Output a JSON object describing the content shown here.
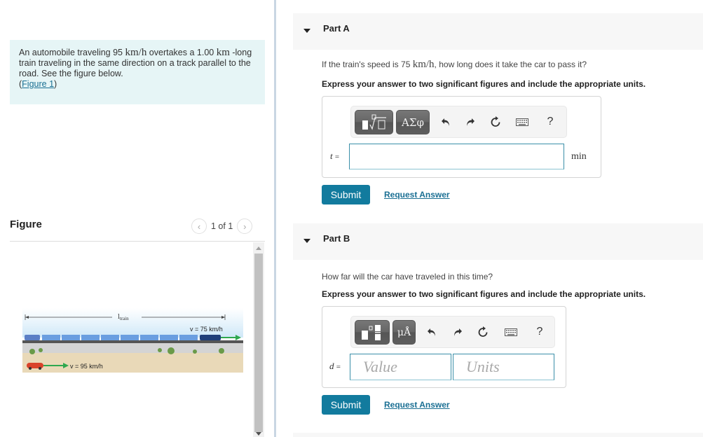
{
  "problem": {
    "text_1": "An automobile traveling 95 ",
    "speed_unit": "km/h",
    "text_2": " overtakes a 1.00 ",
    "length_unit": "km",
    "text_3": " -long train traveling in the same direction on a track parallel to the road. See the figure below.",
    "figure_link_open": "(",
    "figure_link": "Figure 1",
    "figure_link_close": ")"
  },
  "figure": {
    "title": "Figure",
    "counter": "1 of 1",
    "prev_icon": "chevron-left-icon",
    "next_icon": "chevron-right-icon",
    "labels": {
      "length": "l",
      "length_sub": "train",
      "train_speed": "v = 75 km/h",
      "car_speed": "v = 95 km/h"
    },
    "colors": {
      "sky": "#d9eefa",
      "train": "#5b8fd6",
      "car": "#d9432a",
      "arrow": "#2fa84f",
      "ground": "#e9d9b8"
    }
  },
  "parts": [
    {
      "title": "Part A",
      "question_1": "If the train's speed is 75 ",
      "question_unit": "km/h",
      "question_2": ", how long does it take the car to pass it?",
      "instruction": "Express your answer to two significant figures and include the appropriate units.",
      "toolbar": {
        "button_1": "templates-icon",
        "button_2_label": "ΑΣφ",
        "icons": [
          "undo-icon",
          "redo-icon",
          "reset-icon",
          "keyboard-icon",
          "help-icon"
        ],
        "help_label": "?"
      },
      "variable": "t",
      "equals": "=",
      "input_value": "",
      "unit": "min",
      "submit_label": "Submit",
      "request_label": "Request Answer"
    },
    {
      "title": "Part B",
      "question": "How far will the car have traveled in this time?",
      "instruction": "Express your answer to two significant figures and include the appropriate units.",
      "toolbar": {
        "button_1": "templates-icon",
        "button_2_label": "μÅ",
        "icons": [
          "undo-icon",
          "redo-icon",
          "reset-icon",
          "keyboard-icon",
          "help-icon"
        ],
        "help_label": "?"
      },
      "variable": "d",
      "equals": "=",
      "value_placeholder": "Value",
      "units_placeholder": "Units",
      "submit_label": "Submit",
      "request_label": "Request Answer"
    }
  ],
  "colors": {
    "accent": "#127b9e",
    "link": "#1a6f93",
    "problem_bg": "#e6f5f6",
    "part_header_bg": "#f7f7f7"
  }
}
